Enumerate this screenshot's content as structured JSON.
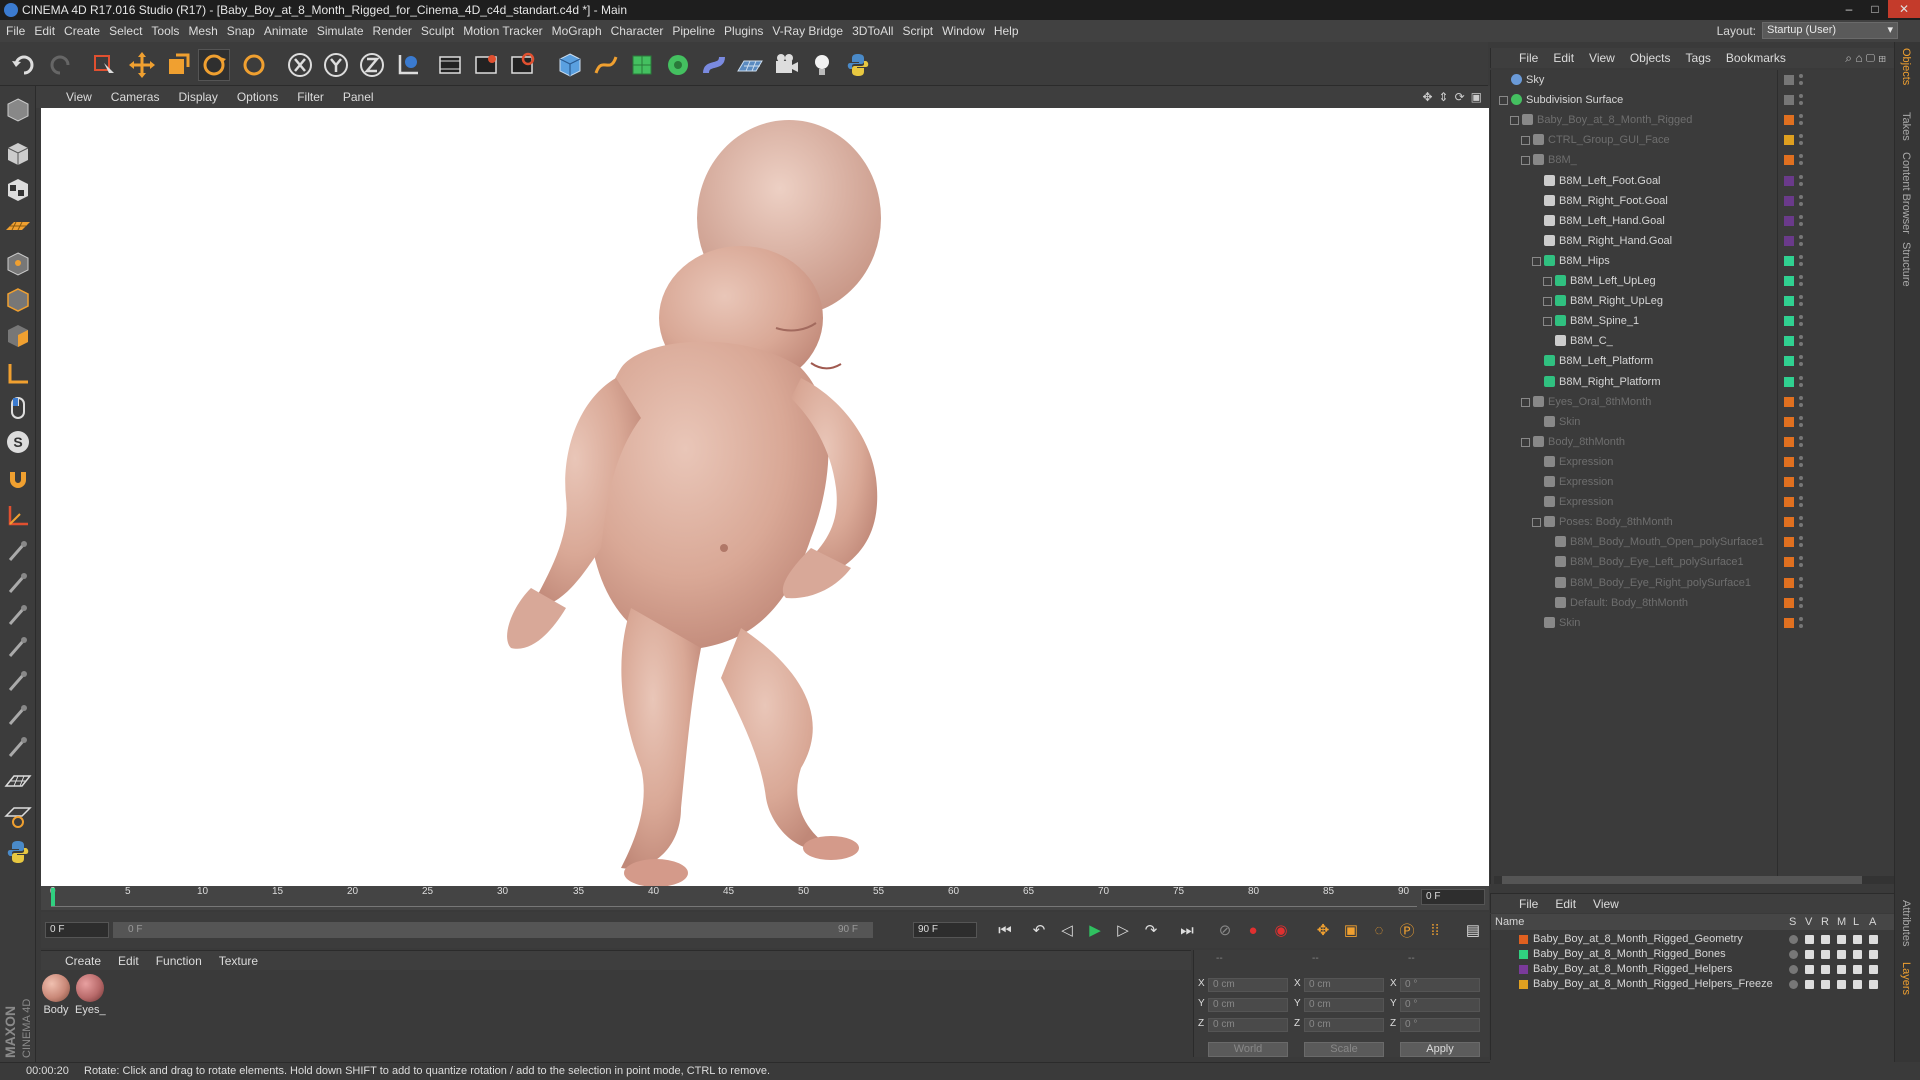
{
  "window": {
    "title": "CINEMA 4D R17.016 Studio (R17) - [Baby_Boy_at_8_Month_Rigged_for_Cinema_4D_c4d_standart.c4d *] - Main"
  },
  "menubar": {
    "items": [
      "File",
      "Edit",
      "Create",
      "Select",
      "Tools",
      "Mesh",
      "Snap",
      "Animate",
      "Simulate",
      "Render",
      "Sculpt",
      "Motion Tracker",
      "MoGraph",
      "Character",
      "Pipeline",
      "Plugins",
      "V-Ray Bridge",
      "3DToAll",
      "Script",
      "Window",
      "Help"
    ],
    "layout_label": "Layout:",
    "layout_value": "Startup (User)"
  },
  "viewport": {
    "menu": [
      "View",
      "Cameras",
      "Display",
      "Options",
      "Filter",
      "Panel"
    ]
  },
  "timeline": {
    "ticks": [
      "0",
      "5",
      "10",
      "15",
      "20",
      "25",
      "30",
      "35",
      "40",
      "45",
      "50",
      "55",
      "60",
      "65",
      "70",
      "75",
      "80",
      "85",
      "90"
    ],
    "current_frame": "0 F"
  },
  "playbar": {
    "start_frame": "0 F",
    "range_start": "0 F",
    "range_end": "90 F",
    "end_frame": "90 F"
  },
  "material_manager": {
    "menu": [
      "Create",
      "Edit",
      "Function",
      "Texture"
    ],
    "materials": [
      {
        "label": "Body",
        "color": "#c98878"
      },
      {
        "label": "Eyes_",
        "color": "#b86a6a"
      }
    ]
  },
  "coordinates": {
    "header_left": "--",
    "header_mid": "--",
    "header_right": "--",
    "rows": [
      {
        "k1": "X",
        "v1": "0 cm",
        "k2": "X",
        "v2": "0 cm",
        "k3": "X",
        "v3": "0 °"
      },
      {
        "k1": "Y",
        "v1": "0 cm",
        "k2": "Y",
        "v2": "0 cm",
        "k3": "Y",
        "v3": "0 °"
      },
      {
        "k1": "Z",
        "v1": "0 cm",
        "k2": "Z",
        "v2": "0 cm",
        "k3": "Z",
        "v3": "0 °"
      }
    ],
    "world": "World",
    "scale": "Scale",
    "apply": "Apply"
  },
  "statusbar": {
    "time": "00:00:20",
    "message": "Rotate: Click and drag to rotate elements. Hold down SHIFT to add to quantize rotation / add to the selection in point mode, CTRL to remove."
  },
  "object_manager": {
    "menu": [
      "File",
      "Edit",
      "View",
      "Objects",
      "Tags",
      "Bookmarks"
    ],
    "rows": [
      {
        "label": "Sky",
        "indent": 0,
        "dim": false,
        "tree": false,
        "icon": "#6a9ad8",
        "swatch": "#777777"
      },
      {
        "label": "Subdivision Surface",
        "indent": 0,
        "dim": false,
        "tree": true,
        "icon": "#44c060",
        "swatch": "#777777"
      },
      {
        "label": "Baby_Boy_at_8_Month_Rigged",
        "indent": 1,
        "dim": true,
        "tree": true,
        "icon": "#888888",
        "swatch": "#e07020"
      },
      {
        "label": "CTRL_Group_GUI_Face",
        "indent": 2,
        "dim": true,
        "tree": true,
        "icon": "#888888",
        "swatch": "#e0a020"
      },
      {
        "label": "B8M_",
        "indent": 2,
        "dim": true,
        "tree": true,
        "icon": "#888888",
        "swatch": "#e07020"
      },
      {
        "label": "B8M_Left_Foot.Goal",
        "indent": 3,
        "dim": false,
        "tree": false,
        "icon": "#cccccc",
        "swatch": "#6a3a8a"
      },
      {
        "label": "B8M_Right_Foot.Goal",
        "indent": 3,
        "dim": false,
        "tree": false,
        "icon": "#cccccc",
        "swatch": "#6a3a8a"
      },
      {
        "label": "B8M_Left_Hand.Goal",
        "indent": 3,
        "dim": false,
        "tree": false,
        "icon": "#cccccc",
        "swatch": "#6a3a8a"
      },
      {
        "label": "B8M_Right_Hand.Goal",
        "indent": 3,
        "dim": false,
        "tree": false,
        "icon": "#cccccc",
        "swatch": "#6a3a8a"
      },
      {
        "label": "B8M_Hips",
        "indent": 3,
        "dim": false,
        "tree": true,
        "icon": "#30c080",
        "swatch": "#30d090"
      },
      {
        "label": "B8M_Left_UpLeg",
        "indent": 4,
        "dim": false,
        "tree": true,
        "icon": "#30c080",
        "swatch": "#30d090"
      },
      {
        "label": "B8M_Right_UpLeg",
        "indent": 4,
        "dim": false,
        "tree": true,
        "icon": "#30c080",
        "swatch": "#30d090"
      },
      {
        "label": "B8M_Spine_1",
        "indent": 4,
        "dim": false,
        "tree": true,
        "icon": "#30c080",
        "swatch": "#30d090"
      },
      {
        "label": "B8M_C_",
        "indent": 4,
        "dim": false,
        "tree": false,
        "icon": "#cccccc",
        "swatch": "#30d090"
      },
      {
        "label": "B8M_Left_Platform",
        "indent": 3,
        "dim": false,
        "tree": false,
        "icon": "#30c080",
        "swatch": "#30d090"
      },
      {
        "label": "B8M_Right_Platform",
        "indent": 3,
        "dim": false,
        "tree": false,
        "icon": "#30c080",
        "swatch": "#30d090"
      },
      {
        "label": "Eyes_Oral_8thMonth",
        "indent": 2,
        "dim": true,
        "tree": true,
        "icon": "#888888",
        "swatch": "#e07020"
      },
      {
        "label": "Skin",
        "indent": 3,
        "dim": true,
        "tree": false,
        "icon": "#888888",
        "swatch": "#e07020"
      },
      {
        "label": "Body_8thMonth",
        "indent": 2,
        "dim": true,
        "tree": true,
        "icon": "#888888",
        "swatch": "#e07020"
      },
      {
        "label": "Expression",
        "indent": 3,
        "dim": true,
        "tree": false,
        "icon": "#888888",
        "swatch": "#e07020"
      },
      {
        "label": "Expression",
        "indent": 3,
        "dim": true,
        "tree": false,
        "icon": "#888888",
        "swatch": "#e07020"
      },
      {
        "label": "Expression",
        "indent": 3,
        "dim": true,
        "tree": false,
        "icon": "#888888",
        "swatch": "#e07020"
      },
      {
        "label": "Poses: Body_8thMonth",
        "indent": 3,
        "dim": true,
        "tree": true,
        "icon": "#888888",
        "swatch": "#e07020"
      },
      {
        "label": "B8M_Body_Mouth_Open_polySurface1",
        "indent": 4,
        "dim": true,
        "tree": false,
        "icon": "#888888",
        "swatch": "#e07020"
      },
      {
        "label": "B8M_Body_Eye_Left_polySurface1",
        "indent": 4,
        "dim": true,
        "tree": false,
        "icon": "#888888",
        "swatch": "#e07020"
      },
      {
        "label": "B8M_Body_Eye_Right_polySurface1",
        "indent": 4,
        "dim": true,
        "tree": false,
        "icon": "#888888",
        "swatch": "#e07020"
      },
      {
        "label": "Default: Body_8thMonth",
        "indent": 4,
        "dim": true,
        "tree": false,
        "icon": "#888888",
        "swatch": "#e07020"
      },
      {
        "label": "Skin",
        "indent": 3,
        "dim": true,
        "tree": false,
        "icon": "#888888",
        "swatch": "#e07020"
      }
    ]
  },
  "layer_manager": {
    "menu": [
      "File",
      "Edit",
      "View"
    ],
    "headers": {
      "name": "Name",
      "s": "S",
      "v": "V",
      "r": "R",
      "m": "M",
      "l": "L",
      "a": "A"
    },
    "layers": [
      {
        "name": "Baby_Boy_at_8_Month_Rigged_Geometry",
        "color": "#e06020"
      },
      {
        "name": "Baby_Boy_at_8_Month_Rigged_Bones",
        "color": "#30d080"
      },
      {
        "name": "Baby_Boy_at_8_Month_Rigged_Helpers",
        "color": "#7a3a9a"
      },
      {
        "name": "Baby_Boy_at_8_Month_Rigged_Helpers_Freeze",
        "color": "#e0a020"
      }
    ]
  },
  "right_tabs": [
    "Objects",
    "Takes",
    "Content Browser",
    "Structure",
    "Attributes",
    "Layers"
  ],
  "branding": {
    "maxon": "MAXON",
    "c4d": "CINEMA 4D"
  },
  "colors": {
    "accent": "#f0a030",
    "ui_bg": "#3a3a3a",
    "viewport_bg": "#ffffff"
  }
}
